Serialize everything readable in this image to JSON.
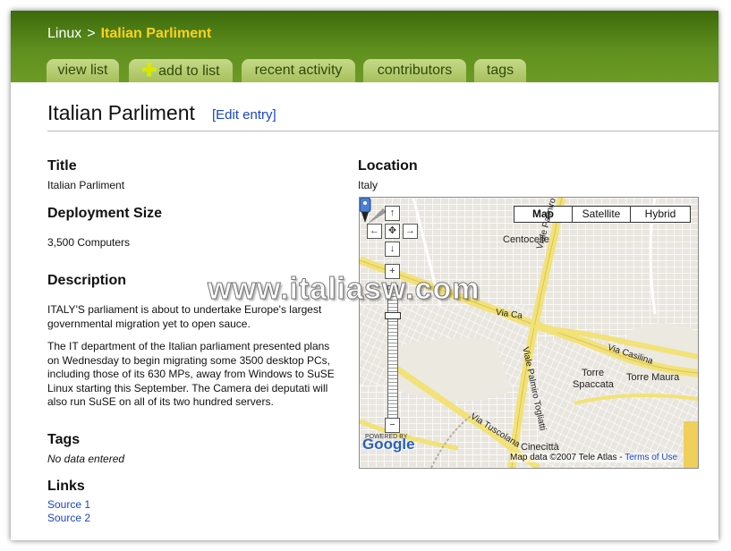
{
  "breadcrumb": {
    "parent": "Linux",
    "separator": ">",
    "current": "Italian Parliment"
  },
  "tabs": [
    {
      "label": "view list"
    },
    {
      "label": "add to list",
      "icon": "plus-icon"
    },
    {
      "label": "recent activity"
    },
    {
      "label": "contributors"
    },
    {
      "label": "tags"
    }
  ],
  "page": {
    "title": "Italian Parliment",
    "edit_link": "[Edit entry]"
  },
  "fields": {
    "title_label": "Title",
    "title_value": "Italian Parliment",
    "deployment_label": "Deployment Size",
    "deployment_value": "3,500 Computers",
    "description_label": "Description",
    "description_p1": "ITALY'S parliament is about to undertake Europe's largest governmental migration yet to open sauce.",
    "description_p2": "The IT department of the Italian parliament presented plans on Wednesday to begin migrating some 3500 desktop PCs, including those of its 630 MPs, away from Windows to SuSE Linux starting this September. The Camera dei deputati will also run SuSE on all of its two hundred servers.",
    "tags_label": "Tags",
    "tags_value": "No data entered",
    "links_label": "Links",
    "links": [
      "Source 1",
      "Source 2"
    ],
    "location_label": "Location",
    "location_value": "Italy"
  },
  "map": {
    "type_buttons": [
      "Map",
      "Satellite",
      "Hybrid"
    ],
    "selected_type": "Map",
    "nav": {
      "up": "↑",
      "left": "←",
      "center": "✥",
      "right": "→",
      "down": "↓",
      "zoom_in": "+",
      "zoom_out": "−"
    },
    "places": [
      "Centocelle",
      "Torre",
      "Spaccata",
      "Torre Maura",
      "Cinecittà"
    ],
    "roads": [
      "Via Ca",
      "Viale Palmiro To",
      "Viale Palmiro Togliatti",
      "Via Casilina",
      "Via Tuscolana"
    ],
    "logo_caption": "POWERED BY",
    "logo": "Google",
    "attribution": "Map data ©2007 Tele Atlas -",
    "terms": "Terms of Use"
  },
  "watermark": "www.italiasw.com",
  "colors": {
    "header_green": "#4e7d14",
    "tab_green": "#b5cc70",
    "breadcrumb_current": "#ffd21a",
    "link_blue": "#1a46c4",
    "road_yellow": "#f5e87a"
  }
}
